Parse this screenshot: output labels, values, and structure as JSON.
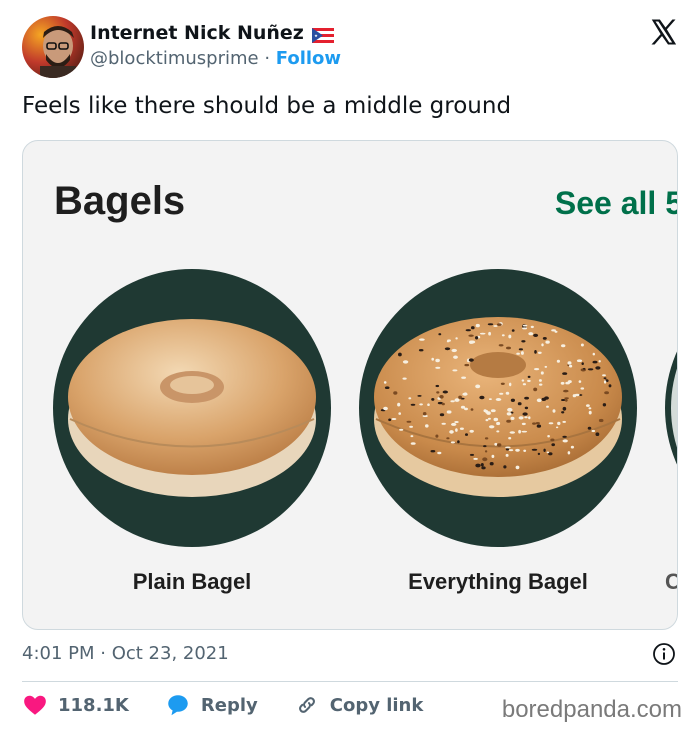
{
  "author": {
    "display_name": "Internet Nick Nuñez",
    "handle": "@blocktimusprime",
    "separator": "·",
    "follow_label": "Follow"
  },
  "tweet": {
    "text": "Feels like there should be a middle ground",
    "timestamp": "4:01 PM · Oct 23, 2021"
  },
  "media": {
    "section_title": "Bagels",
    "see_all_label": "See all 5",
    "cards": [
      {
        "label": "Plain Bagel"
      },
      {
        "label": "Everything Bagel"
      },
      {
        "label": "C"
      }
    ]
  },
  "actions": {
    "likes": "118.1K",
    "reply_label": "Reply",
    "copy_link_label": "Copy link"
  },
  "watermark": "boredpanda.com",
  "colors": {
    "follow": "#1d9bf0",
    "like_heart": "#f91880",
    "reply_bubble": "#1d9bf0",
    "see_all": "#00704a",
    "card_bg": "#1f3933"
  },
  "icons": [
    "x-logo-icon",
    "puerto-rico-flag-icon",
    "info-icon",
    "heart-icon",
    "reply-bubble-icon",
    "link-icon"
  ]
}
